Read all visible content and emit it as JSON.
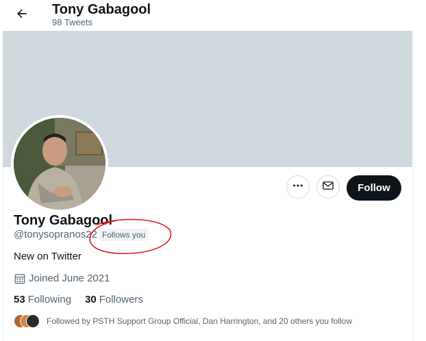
{
  "header": {
    "title": "Tony Gabagool",
    "tweet_count": "98 Tweets"
  },
  "profile": {
    "display_name": "Tony Gabagool",
    "handle": "@tonysopranos22",
    "follows_you_badge": "Follows you",
    "bio": "New on Twitter",
    "joined": "Joined June 2021",
    "following_count": "53",
    "following_label": "Following",
    "followers_count": "30",
    "followers_label": "Followers",
    "followed_by_text": "Followed by PSTH Support Group Official, Dan Harrington, and 20 others you follow"
  },
  "actions": {
    "more_icon": "more-horizontal-icon",
    "message_icon": "envelope-icon",
    "follow_label": "Follow"
  },
  "colors": {
    "banner": "#cfd9de",
    "primary_text": "#0f1419",
    "secondary_text": "#536471",
    "follow_button_bg": "#0f1419",
    "annotation": "#e0161b"
  }
}
